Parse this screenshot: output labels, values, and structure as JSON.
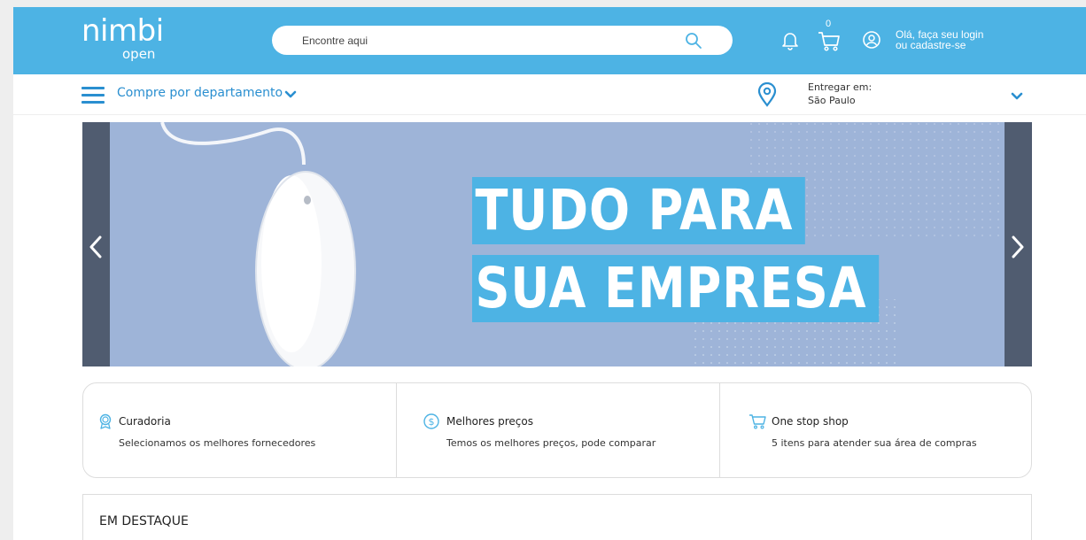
{
  "brand": {
    "name": "nimbi",
    "sub": "open",
    "primary_color": "#4db3e4",
    "link_color": "#2a8fd0"
  },
  "header": {
    "search": {
      "placeholder": "Encontre aqui",
      "value": ""
    },
    "icons": {
      "search": "search-icon",
      "notifications": "bell-icon",
      "cart": "cart-icon",
      "account": "user-icon"
    },
    "cart_count": "0",
    "login": {
      "line1": "Olá, faça seu login",
      "line2": "ou cadastre-se"
    }
  },
  "subnav": {
    "department_label": "Compre por departamento",
    "deliver": {
      "label": "Entregar em:",
      "city": "São Paulo"
    }
  },
  "banner": {
    "headline_line1": "TUDO PARA",
    "headline_line2": "SUA EMPRESA",
    "background_color": "#9eb4d8",
    "arrow_color": "#505c70"
  },
  "features": [
    {
      "icon": "award-icon",
      "title": "Curadoria",
      "description": "Selecionamos os melhores fornecedores"
    },
    {
      "icon": "dollar-icon",
      "title": "Melhores preços",
      "description": "Temos os melhores preços, pode comparar"
    },
    {
      "icon": "cart-icon",
      "title": "One stop shop",
      "description": "5 itens para atender sua área de compras"
    }
  ],
  "highlights": {
    "heading": "EM DESTAQUE"
  }
}
